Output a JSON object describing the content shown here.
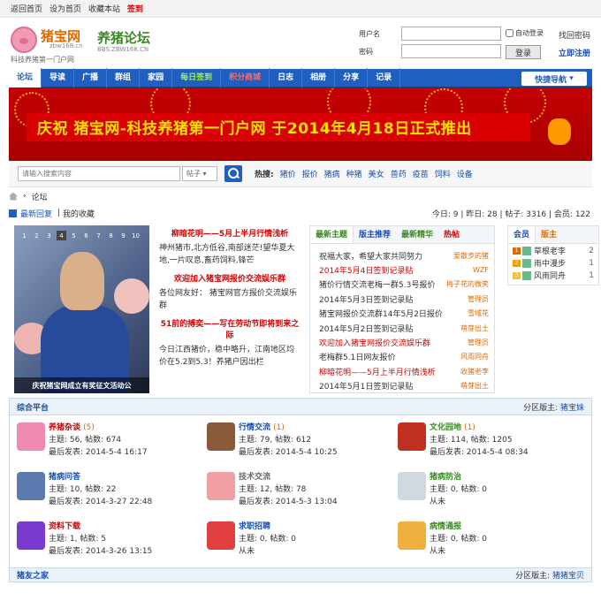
{
  "topbar": {
    "links": [
      "返回首页",
      "设为首页",
      "收藏本站"
    ],
    "sign": "签到"
  },
  "logo": {
    "site_name": "猪宝网",
    "site_url": "zbw168.cn",
    "slogan": "科技养猪第一门户网",
    "forum_name": "养猪论坛",
    "forum_url": "BBS.ZBW168.CN"
  },
  "login": {
    "username_label": "用户名",
    "password_label": "密码",
    "remember": "自动登录",
    "forgot": "找回密码",
    "button": "登录",
    "register": "立即注册"
  },
  "nav": {
    "items": [
      "论坛",
      "导读",
      "广播",
      "群组",
      "家园",
      "每日签到",
      "积分商城",
      "日志",
      "相册",
      "分享",
      "记录"
    ],
    "quick": "快捷导航"
  },
  "banner": {
    "text": "庆祝 猪宝网-科技养猪第一门户网 于2014年4月18日正式推出"
  },
  "search": {
    "placeholder": "请输入搜索内容",
    "scope": "帖子",
    "hot_label": "热搜:",
    "hot_words": [
      "猪价",
      "报价",
      "猪病",
      "种猪",
      "美女",
      "兽药",
      "疫苗",
      "饲料",
      "设备"
    ]
  },
  "breadcrumb": {
    "current": "论坛"
  },
  "stats": {
    "latest": "最新回复",
    "favorites": "我的收藏",
    "today": "今日: 9",
    "yesterday": "昨日: 28",
    "posts": "帖子: 3316",
    "members": "会员: 122"
  },
  "slider": {
    "pages": [
      "1",
      "2",
      "3",
      "4",
      "5",
      "6",
      "7",
      "8",
      "9",
      "10"
    ],
    "active_page": "4",
    "caption": "庆祝猪宝网成立有奖征文活动公"
  },
  "featured": [
    {
      "title": "柳暗花明——5月上半月行情浅析",
      "text": "神州猪市,北方低谷,南部迷茫!望华夏大地,一片叹息,畜药饲料,锋芒"
    },
    {
      "title": "欢迎加入猪宝网报价交流娱乐群",
      "text": "各位网友好： 猪宝网官方报价交流娱乐群"
    },
    {
      "title": "51前的搏奕——写在劳动节即将到来之际",
      "text": "今日江西猪价，稳中略升，江南地区均价在5.2到5.3！养猪户因出栏"
    }
  ],
  "tabs": {
    "items": [
      "最新主题",
      "版主推荐",
      "最新精华",
      "热帖"
    ]
  },
  "threads": [
    {
      "title": "祝福大家，希望大家共同努力",
      "author": "爱散步的猪",
      "red": false
    },
    {
      "title": "2014年5月4日签到记录贴",
      "author": "WZF",
      "red": true
    },
    {
      "title": "猪价行情交流老梅一群5.3号报价",
      "author": "梅子花的微笑",
      "red": false
    },
    {
      "title": "2014年5月3日签到记录贴",
      "author": "管理员",
      "red": false
    },
    {
      "title": "猪宝网报价交流群14年5月2日报价",
      "author": "雪域花",
      "red": false
    },
    {
      "title": "2014年5月2日签到记录贴",
      "author": "萌芽出土",
      "red": false
    },
    {
      "title": "欢迎加入猪宝网报价交流娱乐群",
      "author": "管理员",
      "red": true
    },
    {
      "title": "老梅群5.1日网友报价",
      "author": "风雨同舟",
      "red": false
    },
    {
      "title": "柳暗花明——5月上半月行情浅析",
      "author": "收猪老李",
      "red": true
    },
    {
      "title": "2014年5月1日签到记录贴",
      "author": "萌芽出土",
      "red": false
    }
  ],
  "members_box": {
    "tabs": [
      "会员",
      "版主"
    ],
    "list": [
      {
        "rank": "1",
        "name": "草根老李",
        "count": "2",
        "rank_color": "#e06a00"
      },
      {
        "rank": "2",
        "name": "雨中漫步",
        "count": "1",
        "rank_color": "#f0a000"
      },
      {
        "rank": "3",
        "name": "风雨同舟",
        "count": "1",
        "rank_color": "#f0c040"
      }
    ]
  },
  "forum": {
    "title": "综合平台",
    "moderator_label": "分区版主:",
    "moderator": "猪宝妹",
    "boards": [
      {
        "name": "养猪杂谈",
        "count": "(5)",
        "name_color": "#d40000",
        "stats": "主题: 56, 帖数: 674",
        "last": "最后发表: 2014-5-4 16:17",
        "icon_color": "#f08ab0"
      },
      {
        "name": "行情交流",
        "count": "(1)",
        "name_color": "#1a4fb0",
        "stats": "主题: 79, 帖数: 612",
        "last": "最后发表: 2014-5-4 10:25",
        "icon_color": "#8a5a3a"
      },
      {
        "name": "文化园地",
        "count": "(1)",
        "name_color": "#3a8a22",
        "stats": "主题: 114, 帖数: 1205",
        "last": "最后发表: 2014-5-4 08:34",
        "icon_color": "#c03020"
      },
      {
        "name": "猪病问答",
        "count": "",
        "name_color": "#1a4fb0",
        "stats": "主题: 10, 帖数: 22",
        "last": "最后发表: 2014-3-27 22:48",
        "icon_color": "#5a7ab0"
      },
      {
        "name": "技术交流",
        "count": "",
        "name_color": "#666666",
        "stats": "主题: 12, 帖数: 78",
        "last": "最后发表: 2014-5-3 13:04",
        "icon_color": "#f0a0a0"
      },
      {
        "name": "猪病防治",
        "count": "",
        "name_color": "#3a8a22",
        "stats": "主题: 0, 帖数: 0",
        "last": "从未",
        "icon_color": "#d0d8e0"
      },
      {
        "name": "资料下载",
        "count": "",
        "name_color": "#d40000",
        "stats": "主题: 1, 帖数: 5",
        "last": "最后发表: 2014-3-26 13:15",
        "icon_color": "#7a3ad0"
      },
      {
        "name": "求职招聘",
        "count": "",
        "name_color": "#1a4fb0",
        "stats": "主题: 0, 帖数: 0",
        "last": "从未",
        "icon_color": "#e04040"
      },
      {
        "name": "病情通报",
        "count": "",
        "name_color": "#3a8a22",
        "stats": "主题: 0, 帖数: 0",
        "last": "从未",
        "icon_color": "#f0b040"
      }
    ]
  },
  "section2": {
    "title": "猪友之家",
    "moderator_label": "分区版主:",
    "moderator": "猪猪宝贝"
  }
}
